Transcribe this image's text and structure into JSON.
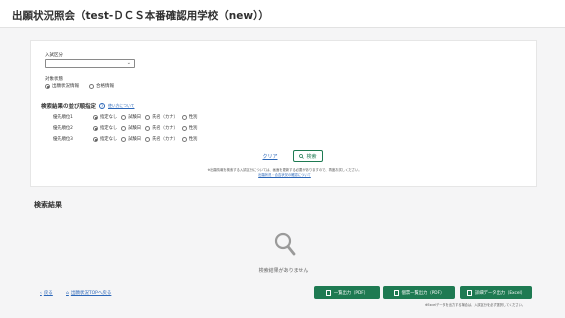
{
  "page": {
    "title": "出願状況照会（test-ＤＣＳ本番確認用学校（new））"
  },
  "search": {
    "exam_label": "入試区分",
    "exam_value": "",
    "target_label": "対象状態",
    "target_options": [
      "出願状況情報",
      "合格情報"
    ],
    "target_selected": 0,
    "section_title": "検索結果の並び順指定",
    "help_link": "使い方について",
    "priorities": [
      {
        "label": "優先順位1",
        "options": [
          "指定なし",
          "試験日",
          "氏名（カナ）",
          "性別"
        ],
        "selected": 0
      },
      {
        "label": "優先順位2",
        "options": [
          "指定なし",
          "試験日",
          "氏名（カナ）",
          "性別"
        ],
        "selected": 0
      },
      {
        "label": "優先順位3",
        "options": [
          "指定なし",
          "試験日",
          "氏名（カナ）",
          "性別"
        ],
        "selected": 0
      }
    ],
    "clear_label": "クリア",
    "search_label": "検索",
    "note": "※出願情報を検索する入試区分については、画面を更新する必要がありますので、再度お試しください。",
    "note_link": "出願状況・合否状況の確認について"
  },
  "results": {
    "title": "検索結果",
    "empty_message": "検索結果がありません"
  },
  "footer": {
    "back_label": "戻る",
    "home_label": "出願状況TOPへ戻る",
    "btn1": "一覧出力（PDF）",
    "btn2": "個票一覧出力（PDF）",
    "btn3": "詳細データ出力（Excel）",
    "note": "※Excelデータを出力する場合は、入試区分を必ず選択してください。"
  },
  "colors": {
    "accent": "#1e7a52",
    "link": "#2a66b8"
  }
}
